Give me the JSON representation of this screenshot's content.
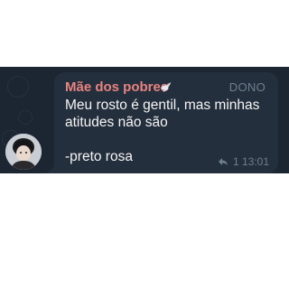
{
  "message": {
    "sender_name": "Mãe dos pobres",
    "sender_badge_icon": "dove-icon",
    "admin_tag": "DONO",
    "text": "Meu rosto é gentil, mas minhas atitudes não são\n\n-preto rosa",
    "reply_count": "1",
    "time": "13:01"
  },
  "colors": {
    "chat_background": "#1c2633",
    "bubble": "#242f3d",
    "sender_name": "#e88380",
    "meta_text": "#6d7f8f"
  }
}
